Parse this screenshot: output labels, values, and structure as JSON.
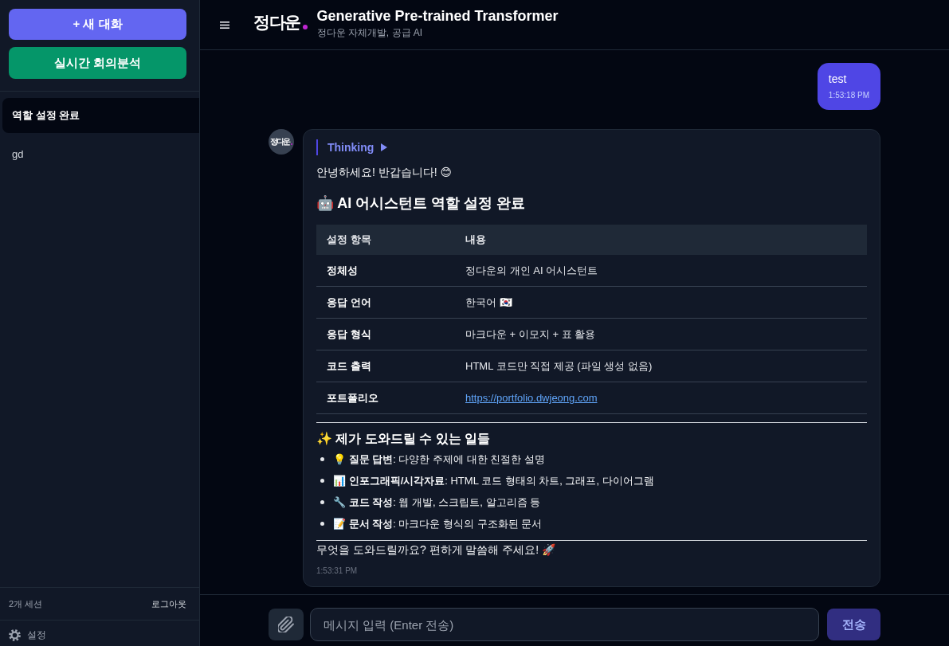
{
  "sidebar": {
    "actions": [
      {
        "label": "+ 새 대화",
        "kind": "primary"
      },
      {
        "label": "실시간 회의분석",
        "kind": "success"
      }
    ],
    "sessions": [
      {
        "title": "역할 설정 완료",
        "selected": true
      },
      {
        "title": "gd",
        "selected": false
      }
    ],
    "footer": {
      "session_count": "2개 세션",
      "logout": "로그아웃",
      "settings": "설정"
    }
  },
  "header": {
    "logo": "정다운",
    "title": "Generative Pre-trained Transformer",
    "subtitle": "정다운 자체개발, 공급 AI"
  },
  "messages": [
    {
      "kind": "user",
      "text": "test",
      "time": "1:53:18 PM"
    },
    {
      "kind": "assistant",
      "avatar": "정다운",
      "thinking": {
        "label": "Thinking",
        "expanded": false
      },
      "blocks": [
        {
          "kind": "paragraph",
          "text": "안녕하세요! 반갑습니다! 😊"
        },
        {
          "kind": "h2",
          "text": "🤖 AI 어시스턴트 역할 설정 완료"
        },
        {
          "kind": "table",
          "columns": [
            "설정 항목",
            "내용"
          ],
          "rows": [
            {
              "label": "정체성",
              "value": "정다운의 개인 AI 어시스턴트",
              "kind": "text"
            },
            {
              "label": "응답 언어",
              "value": "한국어 🇰🇷",
              "kind": "text"
            },
            {
              "label": "응답 형식",
              "value": "마크다운 + 이모지 + 표 활용",
              "kind": "text"
            },
            {
              "label": "코드 출력",
              "value": "HTML 코드만 직접 제공 (파일 생성 없음)",
              "kind": "text"
            },
            {
              "label": "포트폴리오",
              "value": "https://portfolio.dwjeong.com",
              "kind": "link"
            }
          ]
        },
        {
          "kind": "rule"
        },
        {
          "kind": "h3",
          "text": "✨ 제가 도와드릴 수 있는 일들"
        },
        {
          "kind": "list",
          "items": [
            "💡 **질문 답변**: 다양한 주제에 대한 친절한 설명",
            "📊 **인포그래픽/시각자료**: HTML 코드 형태의 차트, 그래프, 다이어그램",
            "🔧 **코드 작성**: 웹 개발, 스크립트, 알고리즘 등",
            "📝 **문서 작성**: 마크다운 형식의 구조화된 문서"
          ]
        },
        {
          "kind": "rule"
        },
        {
          "kind": "paragraph",
          "text": "무엇을 도와드릴까요? 편하게 말씀해 주세요! 🚀"
        }
      ],
      "time": "1:53:31 PM"
    }
  ],
  "composer": {
    "placeholder": "메시지 입력 (Enter 전송)",
    "send": {
      "label": "전송",
      "disabled": true
    }
  }
}
